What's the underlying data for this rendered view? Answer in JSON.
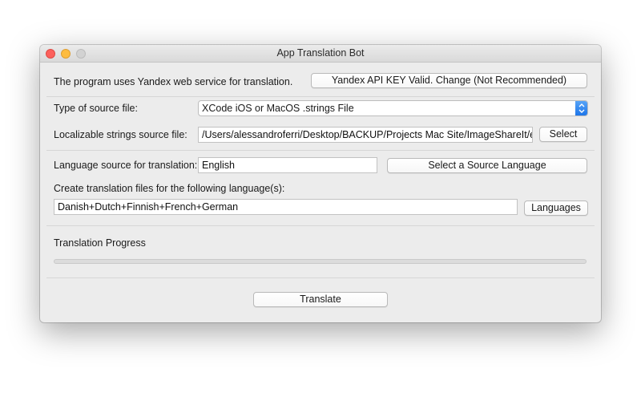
{
  "window": {
    "title": "App Translation Bot"
  },
  "api": {
    "info_text": "The program uses Yandex web service for translation.",
    "key_button_label": "Yandex API KEY Valid. Change (Not Recommended)"
  },
  "source": {
    "type_label": "Type of source file:",
    "type_selected": "XCode iOS or MacOS .strings File",
    "file_label": "Localizable strings source file:",
    "file_path": "/Users/alessandroferri/Desktop/BACKUP/Projects Mac Site/ImageShareIt/en.lproj/Localizable.strings",
    "select_button_label": "Select"
  },
  "language": {
    "source_label": "Language source for translation:",
    "source_value": "English",
    "select_source_button_label": "Select a Source Language",
    "targets_label": "Create translation files for the following language(s):",
    "targets_value": "Danish+Dutch+Finnish+French+German",
    "languages_button_label": "Languages"
  },
  "progress": {
    "label": "Translation Progress",
    "fraction": 0
  },
  "actions": {
    "translate_button_label": "Translate"
  },
  "colors": {
    "accent": "#1a73e8",
    "window_background": "#ececec"
  },
  "icons": {
    "close": "close-traffic-light",
    "minimize": "minimize-traffic-light",
    "zoom": "zoom-traffic-light",
    "popup": "chevron-up-down-icon"
  }
}
